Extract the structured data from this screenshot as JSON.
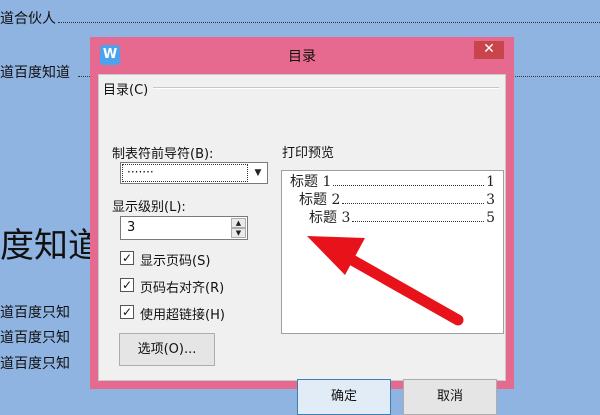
{
  "document": {
    "line1": "道合伙人",
    "line2": "道百度知道",
    "heading": "度知道",
    "paragraphs": [
      "道百度只知",
      "道百度只知",
      "道百度只知"
    ]
  },
  "dialog": {
    "app_icon": "W",
    "title": "目录",
    "close_glyph": "✕",
    "group_label": "目录(C)",
    "leader_label": "制表符前导符(B):",
    "leader_value": "·······",
    "level_label": "显示级别(L):",
    "level_value": "3",
    "checkboxes": [
      {
        "label": "显示页码(S)",
        "checked": "✓"
      },
      {
        "label": "页码右对齐(R)",
        "checked": "✓"
      },
      {
        "label": "使用超链接(H)",
        "checked": "✓"
      }
    ],
    "options_button": "选项(O)...",
    "preview_label": "打印预览",
    "preview_rows": [
      {
        "title": "标题 1",
        "page": "1"
      },
      {
        "title": "标题 2",
        "page": "3"
      },
      {
        "title": "标题 3",
        "page": "5"
      }
    ],
    "ok_button": "确定",
    "cancel_button": "取消"
  },
  "annotation": {
    "arrow_color": "#e8121a",
    "icon": "red-arrow-pointing-up-left"
  }
}
